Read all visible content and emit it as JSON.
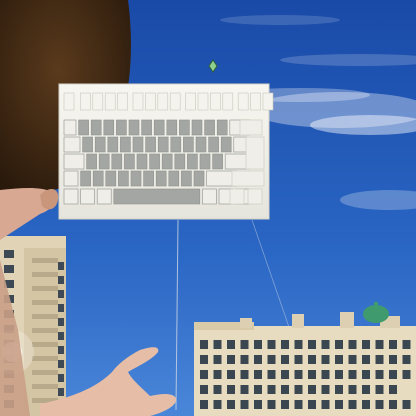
{
  "scene": {
    "description_labels": {
      "sky": "sky",
      "keyboard": "keyboard-kite",
      "person": "person",
      "buildings": "buildings"
    },
    "colors": {
      "sky_top": "#1a4fb0",
      "sky_bottom": "#3f7fd6",
      "cloud": "#ffffff",
      "keyboard_body": "#f2f1ea",
      "key_light": "#eeeeea",
      "key_dark": "#9c9e9c",
      "hair": "#3a2614",
      "skin": "#e3b9a2",
      "building_light": "#e9dcc1",
      "building_window": "#3d4a55",
      "dome": "#3f9a6e"
    },
    "keyboard": {
      "function_row_keys": 16,
      "main_rows": [
        14,
        14,
        13,
        12,
        8
      ]
    }
  }
}
